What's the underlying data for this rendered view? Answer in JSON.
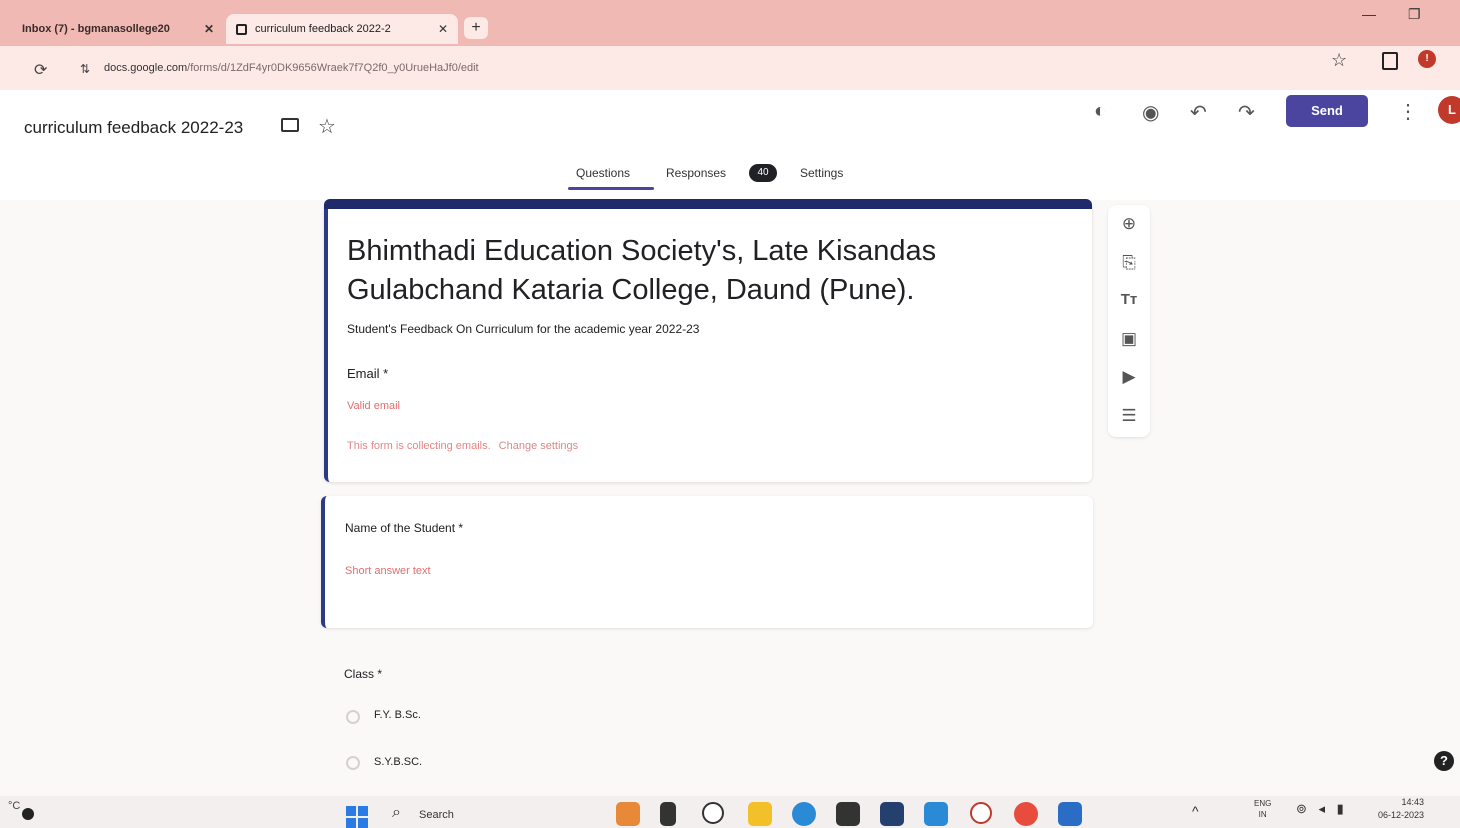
{
  "browser": {
    "tabs": [
      {
        "title": "Inbox (7) - bgmanasollege20"
      },
      {
        "title": "curriculum feedback 2022-2"
      }
    ],
    "url_host": "docs.google.com",
    "url_path": "/forms/d/1ZdF4yr0DK9656Wraek7f7Q2f0_y0UrueHaJf0/edit"
  },
  "app": {
    "doc_title": "curriculum feedback 2022-23",
    "send_label": "Send",
    "avatar_initial": "L",
    "tabs": {
      "questions": "Questions",
      "responses": "Responses",
      "responses_count": "40",
      "settings": "Settings"
    }
  },
  "form": {
    "heading": "Bhimthadi Education Society's, Late Kisandas Gulabchand Kataria College, Daund (Pune).",
    "description": "Student's Feedback On Curriculum for the academic year 2022-23",
    "email": {
      "label": "Email *",
      "placeholder": "Valid email",
      "note": "This form is collecting emails.",
      "note_link": "Change settings"
    },
    "name_question": {
      "label": "Name of the Student *",
      "placeholder": "Short answer text"
    },
    "class_question": {
      "label": "Class *",
      "options": [
        "F.Y. B.Sc.",
        "S.Y.B.SC."
      ]
    }
  },
  "taskbar": {
    "search_label": "Search",
    "weather_temp": "°C",
    "lang": "ENG",
    "lang_sub": "IN",
    "time": "14:43",
    "date": "06-12-2023"
  },
  "colors": {
    "accent": "#4b45a0",
    "form_band": "#1f2a6b",
    "placeholder": "#e06f6f"
  }
}
